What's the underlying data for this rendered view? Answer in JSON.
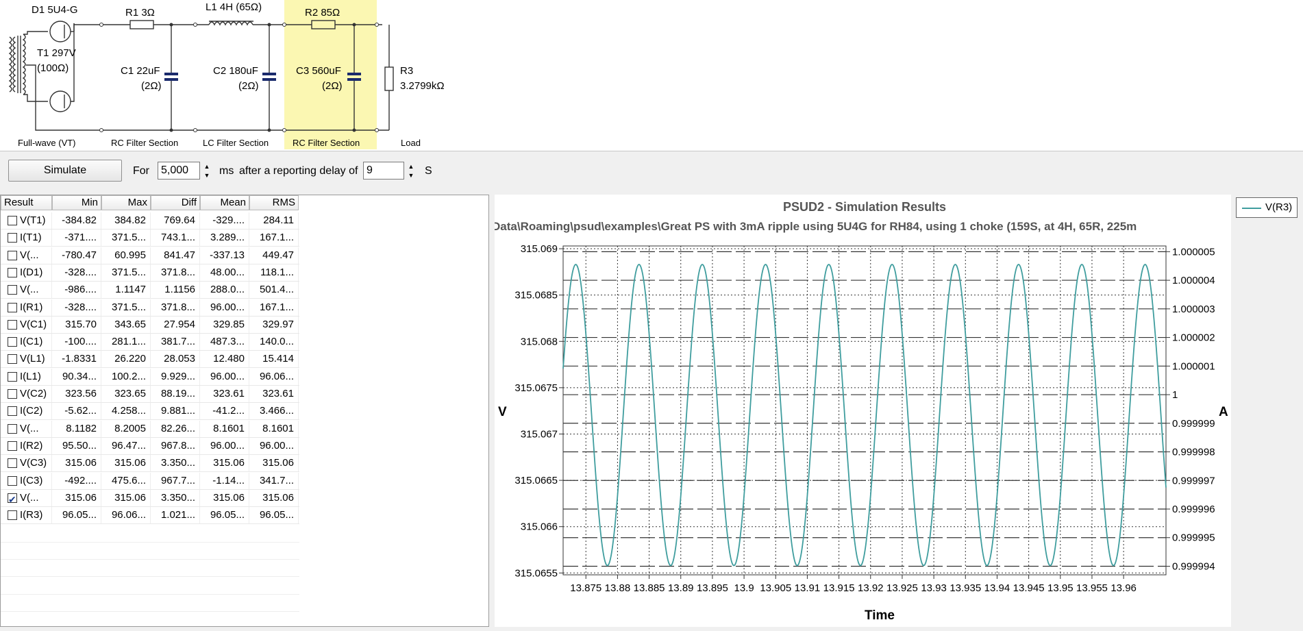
{
  "schematic": {
    "components": {
      "d1": "D1 5U4-G",
      "r1": "R1 3Ω",
      "l1": "L1 4H (65Ω)",
      "r2": "R2 85Ω",
      "t1_a": "T1 297V",
      "t1_b": "(100Ω)",
      "c1_a": "C1 22uF",
      "c1_b": "(2Ω)",
      "c2_a": "C2 180uF",
      "c2_b": "(2Ω)",
      "c3_a": "C3 560uF",
      "c3_b": "(2Ω)",
      "r3_a": "R3",
      "r3_b": "3.2799kΩ"
    },
    "sections": [
      "Full-wave (VT)",
      "RC Filter Section",
      "LC Filter Section",
      "RC Filter Section",
      "Load"
    ],
    "highlight_color": "#fbf7b2"
  },
  "toolbar": {
    "simulate_label": "Simulate",
    "for_label": "For",
    "duration_value": "5,000",
    "ms_label": "ms",
    "delay_label": "after a reporting delay of",
    "delay_value": "9",
    "s_label": "S"
  },
  "results": {
    "columns": [
      "Result",
      "Min",
      "Max",
      "Diff",
      "Mean",
      "RMS"
    ],
    "rows": [
      {
        "name": "V(T1)",
        "min": "-384.82",
        "max": "384.82",
        "diff": "769.64",
        "mean": "-329....",
        "rms": "284.11",
        "checked": false
      },
      {
        "name": "I(T1)",
        "min": "-371....",
        "max": "371.5...",
        "diff": "743.1...",
        "mean": "3.289...",
        "rms": "167.1...",
        "checked": false
      },
      {
        "name": "V(...",
        "min": "-780.47",
        "max": "60.995",
        "diff": "841.47",
        "mean": "-337.13",
        "rms": "449.47",
        "checked": false
      },
      {
        "name": "I(D1)",
        "min": "-328....",
        "max": "371.5...",
        "diff": "371.8...",
        "mean": "48.00...",
        "rms": "118.1...",
        "checked": false
      },
      {
        "name": "V(...",
        "min": "-986....",
        "max": "1.1147",
        "diff": "1.1156",
        "mean": "288.0...",
        "rms": "501.4...",
        "checked": false
      },
      {
        "name": "I(R1)",
        "min": "-328....",
        "max": "371.5...",
        "diff": "371.8...",
        "mean": "96.00...",
        "rms": "167.1...",
        "checked": false
      },
      {
        "name": "V(C1)",
        "min": "315.70",
        "max": "343.65",
        "diff": "27.954",
        "mean": "329.85",
        "rms": "329.97",
        "checked": false
      },
      {
        "name": "I(C1)",
        "min": "-100....",
        "max": "281.1...",
        "diff": "381.7...",
        "mean": "487.3...",
        "rms": "140.0...",
        "checked": false
      },
      {
        "name": "V(L1)",
        "min": "-1.8331",
        "max": "26.220",
        "diff": "28.053",
        "mean": "12.480",
        "rms": "15.414",
        "checked": false
      },
      {
        "name": "I(L1)",
        "min": "90.34...",
        "max": "100.2...",
        "diff": "9.929...",
        "mean": "96.00...",
        "rms": "96.06...",
        "checked": false
      },
      {
        "name": "V(C2)",
        "min": "323.56",
        "max": "323.65",
        "diff": "88.19...",
        "mean": "323.61",
        "rms": "323.61",
        "checked": false
      },
      {
        "name": "I(C2)",
        "min": "-5.62...",
        "max": "4.258...",
        "diff": "9.881...",
        "mean": "-41.2...",
        "rms": "3.466...",
        "checked": false
      },
      {
        "name": "V(...",
        "min": "8.1182",
        "max": "8.2005",
        "diff": "82.26...",
        "mean": "8.1601",
        "rms": "8.1601",
        "checked": false
      },
      {
        "name": "I(R2)",
        "min": "95.50...",
        "max": "96.47...",
        "diff": "967.8...",
        "mean": "96.00...",
        "rms": "96.00...",
        "checked": false
      },
      {
        "name": "V(C3)",
        "min": "315.06",
        "max": "315.06",
        "diff": "3.350...",
        "mean": "315.06",
        "rms": "315.06",
        "checked": false
      },
      {
        "name": "I(C3)",
        "min": "-492....",
        "max": "475.6...",
        "diff": "967.7...",
        "mean": "-1.14...",
        "rms": "341.7...",
        "checked": false
      },
      {
        "name": "V(...",
        "min": "315.06",
        "max": "315.06",
        "diff": "3.350...",
        "mean": "315.06",
        "rms": "315.06",
        "checked": true
      },
      {
        "name": "I(R3)",
        "min": "96.05...",
        "max": "96.06...",
        "diff": "1.021...",
        "mean": "96.05...",
        "rms": "96.05...",
        "checked": false
      }
    ]
  },
  "chart_data": {
    "type": "line",
    "title": "PSUD2 - Simulation Results",
    "subtitle": "Data\\Roaming\\psud\\examples\\Great PS with 3mA ripple using 5U4G for RH84, using 1 choke (159S, at 4H, 65R, 225m",
    "xlabel": "Time",
    "ylabel": "V",
    "y2label": "A",
    "xlim": [
      13.8714,
      13.9667
    ],
    "ylim": [
      315.06548,
      315.06903
    ],
    "y2lim": [
      0.9999937,
      1.0000052
    ],
    "x_ticks": [
      "13.875",
      "13.88",
      "13.885",
      "13.89",
      "13.895",
      "13.9",
      "13.905",
      "13.91",
      "13.915",
      "13.92",
      "13.925",
      "13.93",
      "13.935",
      "13.94",
      "13.945",
      "13.95",
      "13.955",
      "13.96"
    ],
    "y_ticks": [
      "315.069",
      "315.0685",
      "315.068",
      "315.0675",
      "315.067",
      "315.0665",
      "315.066",
      "315.0655"
    ],
    "y2_ticks": [
      "1.000005",
      "1.000004",
      "1.000003",
      "1.000002",
      "1.000001",
      "1",
      "0.999999",
      "0.999998",
      "0.999997",
      "0.999996",
      "0.999995",
      "0.999994"
    ],
    "series": [
      {
        "name": "V(R3)",
        "color": "#3f9d9e",
        "period": 0.01,
        "peak_x": [
          13.8734,
          13.8834,
          13.8934,
          13.9034,
          13.9134,
          13.9234,
          13.9334,
          13.9434,
          13.9534,
          13.9634
        ],
        "trough_x": [
          13.8784,
          13.8884,
          13.8984,
          13.9084,
          13.9184,
          13.9284,
          13.9384,
          13.9484,
          13.9584
        ],
        "max": 315.06883,
        "min": 315.06558
      }
    ],
    "grid": true,
    "legend": "top-right"
  }
}
